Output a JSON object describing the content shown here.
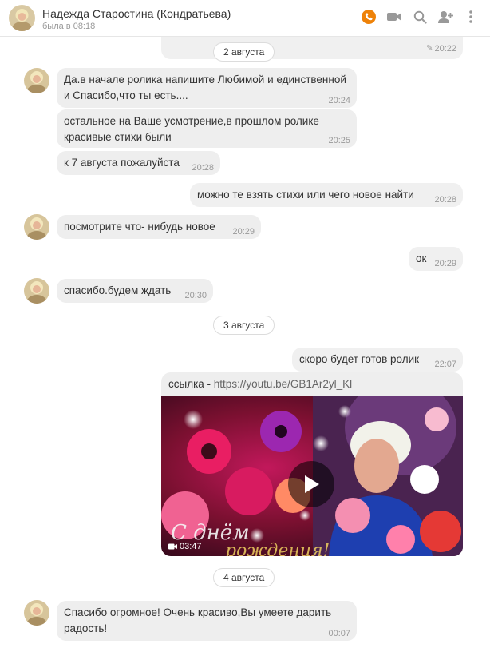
{
  "header": {
    "contact_name": "Надежда Старостина (Кондратьева)",
    "status": "была в 08:18",
    "icons": [
      "phone-icon",
      "video-call-icon",
      "search-icon",
      "add-user-icon",
      "more-icon"
    ],
    "accent": "#ee8208"
  },
  "messages": {
    "m0_time": "20:22",
    "date1": "2 августа",
    "m1_text": "Да.в начале ролика напишите Любимой и единственной и Спасибо,что ты есть....",
    "m1_time": "20:24",
    "m2_text": "остальное на Ваше усмотрение,в прошлом ролике красивые стихи были",
    "m2_time": "20:25",
    "m3_text": "к 7 августа пожалуйста",
    "m3_time": "20:28",
    "m4_text": "можно те взять стихи или чего новое найти",
    "m4_time": "20:28",
    "m5_text": "посмотрите что- нибудь новое",
    "m5_time": "20:29",
    "m6_text": "ок",
    "m6_time": "20:29",
    "m7_text": "спасибо.будем ждать",
    "m7_time": "20:30",
    "date2": "3 августа",
    "m8_text": "скоро будет готов ролик",
    "m8_time": "22:07",
    "link_label": "ссылка - ",
    "link_url": "https://youtu.be/GB1Ar2yl_Kl",
    "video_duration": "03:47",
    "date3": "4 августа",
    "m9_text": "Спасибо огромное! Очень красиво,Вы умеете дарить радость!",
    "m9_time": "00:07"
  }
}
